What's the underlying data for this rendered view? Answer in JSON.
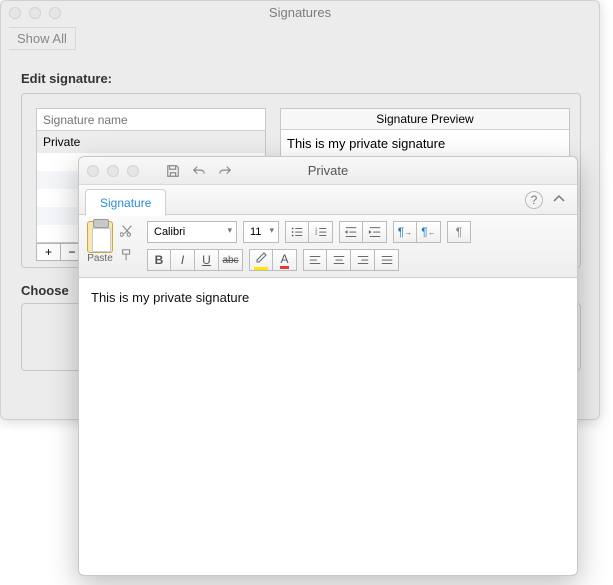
{
  "parent": {
    "title": "Signatures",
    "show_all": "Show All",
    "edit_label": "Edit signature:",
    "sig_name_header": "Signature name",
    "sig_row": "Private",
    "plus": "+",
    "minus": "−",
    "preview_header": "Signature Preview",
    "preview_text": "This is my private signature",
    "choose_label": "Choose"
  },
  "editor": {
    "title": "Private",
    "tab": "Signature",
    "help": "?",
    "paste_label": "Paste",
    "font_name": "Calibri",
    "font_size": "11",
    "bold": "B",
    "italic": "I",
    "underline": "U",
    "strike": "abc",
    "highlight": "A",
    "fontcolor": "A",
    "pilcrow1": "¶",
    "pilcrow2": "¶",
    "pilcrow3": "¶",
    "body": "This is my private signature"
  }
}
